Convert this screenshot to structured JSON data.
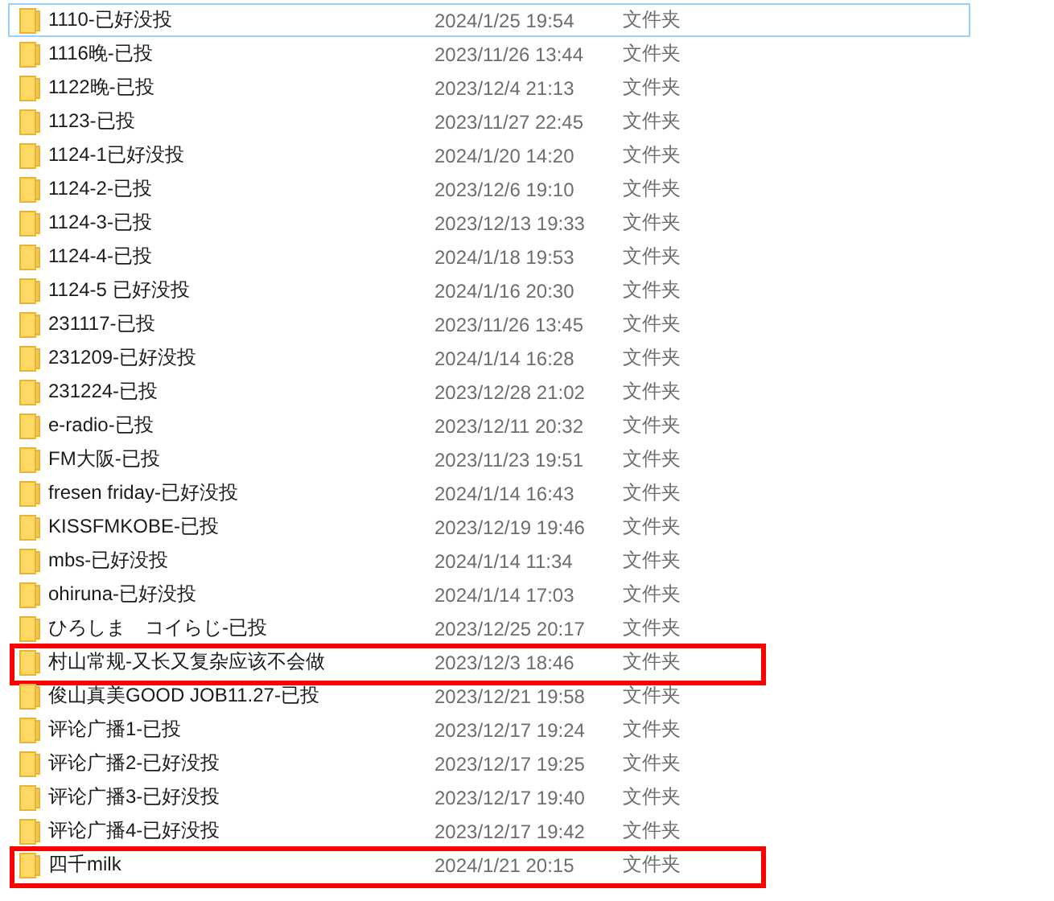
{
  "files": [
    {
      "name": "1110-已好没投",
      "modified": "2024/1/25 19:54",
      "type": "文件夹",
      "focused": true,
      "annotated": false
    },
    {
      "name": "1116晚-已投",
      "modified": "2023/11/26 13:44",
      "type": "文件夹",
      "focused": false,
      "annotated": false
    },
    {
      "name": "1122晚-已投",
      "modified": "2023/12/4 21:13",
      "type": "文件夹",
      "focused": false,
      "annotated": false
    },
    {
      "name": "1123-已投",
      "modified": "2023/11/27 22:45",
      "type": "文件夹",
      "focused": false,
      "annotated": false
    },
    {
      "name": "1124-1已好没投",
      "modified": "2024/1/20 14:20",
      "type": "文件夹",
      "focused": false,
      "annotated": false
    },
    {
      "name": "1124-2-已投",
      "modified": "2023/12/6 19:10",
      "type": "文件夹",
      "focused": false,
      "annotated": false
    },
    {
      "name": "1124-3-已投",
      "modified": "2023/12/13 19:33",
      "type": "文件夹",
      "focused": false,
      "annotated": false
    },
    {
      "name": "1124-4-已投",
      "modified": "2024/1/18 19:53",
      "type": "文件夹",
      "focused": false,
      "annotated": false
    },
    {
      "name": "1124-5 已好没投",
      "modified": "2024/1/16 20:30",
      "type": "文件夹",
      "focused": false,
      "annotated": false
    },
    {
      "name": "231117-已投",
      "modified": "2023/11/26 13:45",
      "type": "文件夹",
      "focused": false,
      "annotated": false
    },
    {
      "name": "231209-已好没投",
      "modified": "2024/1/14 16:28",
      "type": "文件夹",
      "focused": false,
      "annotated": false
    },
    {
      "name": "231224-已投",
      "modified": "2023/12/28 21:02",
      "type": "文件夹",
      "focused": false,
      "annotated": false
    },
    {
      "name": "e-radio-已投",
      "modified": "2023/12/11 20:32",
      "type": "文件夹",
      "focused": false,
      "annotated": false
    },
    {
      "name": "FM大阪-已投",
      "modified": "2023/11/23 19:51",
      "type": "文件夹",
      "focused": false,
      "annotated": false
    },
    {
      "name": "fresen friday-已好没投",
      "modified": "2024/1/14 16:43",
      "type": "文件夹",
      "focused": false,
      "annotated": false
    },
    {
      "name": "KISSFMKOBE-已投",
      "modified": "2023/12/19 19:46",
      "type": "文件夹",
      "focused": false,
      "annotated": false
    },
    {
      "name": "mbs-已好没投",
      "modified": "2024/1/14 11:34",
      "type": "文件夹",
      "focused": false,
      "annotated": false
    },
    {
      "name": "ohiruna-已好没投",
      "modified": "2024/1/14 17:03",
      "type": "文件夹",
      "focused": false,
      "annotated": false
    },
    {
      "name": "ひろしま　コイらじ-已投",
      "modified": "2023/12/25 20:17",
      "type": "文件夹",
      "focused": false,
      "annotated": false
    },
    {
      "name": "村山常规-又长又复杂应该不会做",
      "modified": "2023/12/3 18:46",
      "type": "文件夹",
      "focused": false,
      "annotated": true
    },
    {
      "name": "俊山真美GOOD JOB11.27-已投",
      "modified": "2023/12/21 19:58",
      "type": "文件夹",
      "focused": false,
      "annotated": false
    },
    {
      "name": "评论广播1-已投",
      "modified": "2023/12/17 19:24",
      "type": "文件夹",
      "focused": false,
      "annotated": false
    },
    {
      "name": "评论广播2-已好没投",
      "modified": "2023/12/17 19:25",
      "type": "文件夹",
      "focused": false,
      "annotated": false
    },
    {
      "name": "评论广播3-已好没投",
      "modified": "2023/12/17 19:40",
      "type": "文件夹",
      "focused": false,
      "annotated": false
    },
    {
      "name": "评论广播4-已好没投",
      "modified": "2023/12/17 19:42",
      "type": "文件夹",
      "focused": false,
      "annotated": false
    },
    {
      "name": "四千milk",
      "modified": "2024/1/21 20:15",
      "type": "文件夹",
      "focused": false,
      "annotated": true
    }
  ]
}
